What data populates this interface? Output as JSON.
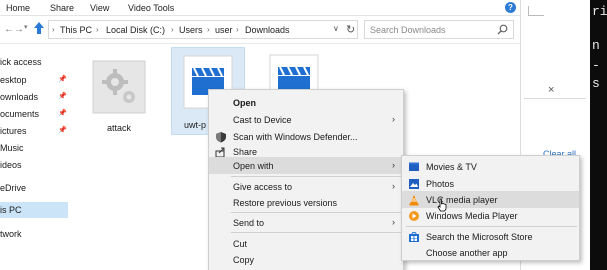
{
  "ribbon": {
    "tabs": [
      "Home",
      "Share",
      "View",
      "Video Tools"
    ],
    "help_label": "?"
  },
  "address": {
    "crumbs": [
      "This PC",
      "Local Disk (C:)",
      "Users",
      "user",
      "Downloads"
    ],
    "refresh_icon": "refresh-icon"
  },
  "search": {
    "placeholder": "Search Downloads"
  },
  "sidebar": {
    "items": [
      {
        "label": "ick access",
        "pinned": false
      },
      {
        "label": "esktop",
        "pinned": true
      },
      {
        "label": "ownloads",
        "pinned": true
      },
      {
        "label": "ocuments",
        "pinned": true
      },
      {
        "label": "ictures",
        "pinned": true
      },
      {
        "label": "Music",
        "pinned": false
      },
      {
        "label": "ideos",
        "pinned": false
      },
      {
        "label": "eDrive",
        "pinned": false
      },
      {
        "label": "is PC",
        "pinned": false,
        "selected": true
      },
      {
        "label": "twork",
        "pinned": false
      }
    ]
  },
  "files": [
    {
      "name": "attack",
      "type": "settings-file-icon"
    },
    {
      "name": "uwt-p",
      "type": "video-clapper-icon",
      "selected": true
    },
    {
      "name": "",
      "type": "video-clapper-icon"
    }
  ],
  "context_menu": {
    "items": [
      {
        "label": "Open",
        "bold": true
      },
      {
        "label": "Cast to Device",
        "submenu": true
      },
      {
        "label": "Scan with Windows Defender...",
        "icon": "defender-icon"
      },
      {
        "label": "Share",
        "icon": "share-icon"
      },
      {
        "label": "Open with",
        "submenu": true,
        "highlighted": true
      },
      {
        "label": "Give access to",
        "submenu": true
      },
      {
        "label": "Restore previous versions"
      },
      {
        "label": "Send to",
        "submenu": true
      },
      {
        "label": "Cut"
      },
      {
        "label": "Copy"
      }
    ]
  },
  "open_with_menu": {
    "items": [
      {
        "label": "Movies & TV",
        "icon": "movies-tv-icon"
      },
      {
        "label": "Photos",
        "icon": "photos-icon"
      },
      {
        "label": "VLC media player",
        "icon": "vlc-icon",
        "highlighted": true
      },
      {
        "label": "Windows Media Player",
        "icon": "media-player-icon"
      },
      {
        "label": "Search the Microsoft Store",
        "icon": "store-icon"
      },
      {
        "label": "Choose another app"
      }
    ]
  },
  "right_panel": {
    "close_label": "×",
    "clear_all": "Clear all",
    "terminal_lines": [
      "ri",
      "n",
      "-",
      "",
      "s"
    ]
  },
  "colors": {
    "accent": "#2b7bd6",
    "selection": "#cce4f7",
    "menu_bg": "#f2f2f2",
    "vlc_orange": "#f28a00"
  }
}
